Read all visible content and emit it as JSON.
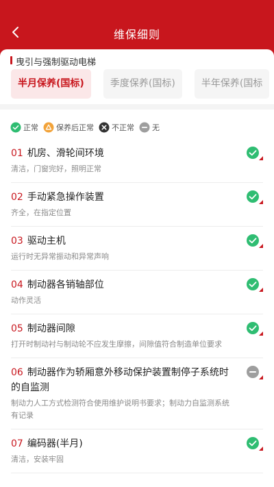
{
  "header": {
    "title": "维保细则"
  },
  "category": {
    "title": "曳引与强制驱动电梯"
  },
  "tabs": [
    {
      "label": "半月保养(国标)",
      "active": true
    },
    {
      "label": "季度保养(国标)",
      "active": false
    },
    {
      "label": "半年保养(国标",
      "active": false
    }
  ],
  "legend": [
    {
      "label": "正常",
      "icon": "check-icon",
      "color": "#2fbd72"
    },
    {
      "label": "保养后正常",
      "icon": "triangle-icon",
      "color": "#f2a33a"
    },
    {
      "label": "不正常",
      "icon": "x-icon",
      "color": "#333333"
    },
    {
      "label": "无",
      "icon": "minus-icon",
      "color": "#9e9e9e"
    }
  ],
  "items": [
    {
      "num": "01",
      "title": "机房、滑轮间环境",
      "desc": "清洁，门窗完好，照明正常",
      "status": "normal"
    },
    {
      "num": "02",
      "title": "手动紧急操作装置",
      "desc": "齐全，在指定位置",
      "status": "normal"
    },
    {
      "num": "03",
      "title": "驱动主机",
      "desc": "运行时无异常振动和异常声响",
      "status": "normal"
    },
    {
      "num": "04",
      "title": "制动器各销轴部位",
      "desc": "动作灵活",
      "status": "normal"
    },
    {
      "num": "05",
      "title": "制动器间隙",
      "desc": "打开时制动衬与制动轮不应发生摩擦，间隙值符合制造单位要求",
      "status": "normal"
    },
    {
      "num": "06",
      "title": "制动器作为轿厢意外移动保护装置制停子系统时的自监测",
      "desc": "制动力人工方式检测符合使用维护说明书要求；制动力自监测系统有记录",
      "status": "none"
    },
    {
      "num": "07",
      "title": "编码器(半月)",
      "desc": "清洁，安装牢固",
      "status": "normal"
    }
  ],
  "colors": {
    "brand": "#c8161d",
    "normal": "#2fbd72",
    "none": "#9e9e9e"
  }
}
